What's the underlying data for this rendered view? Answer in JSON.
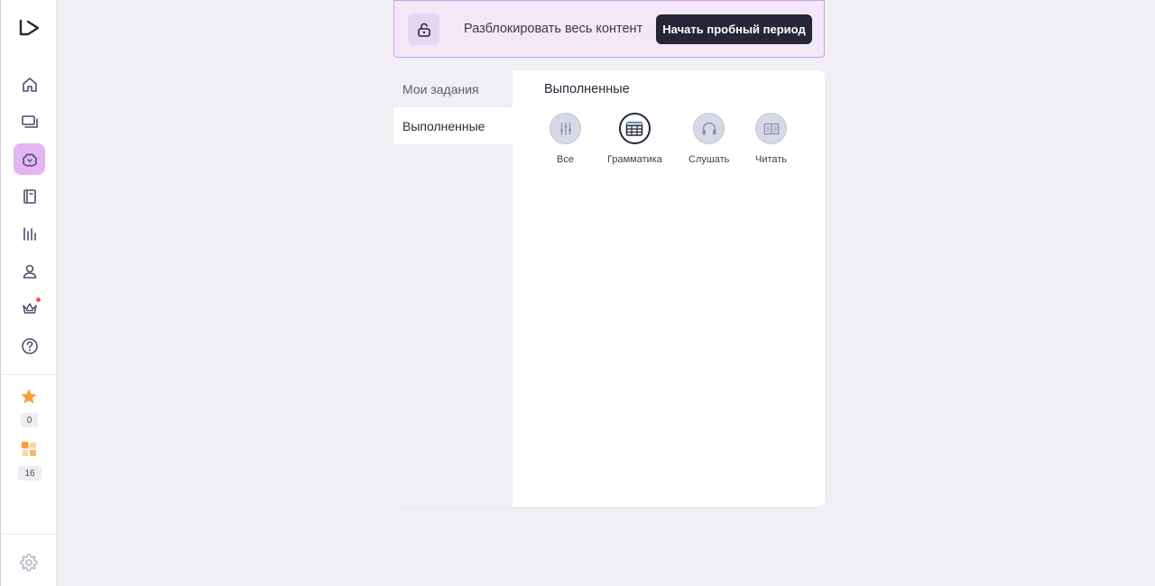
{
  "sidebar": {
    "logo": "logo-icon",
    "nav_items": [
      {
        "name": "home",
        "icon": "home-icon"
      },
      {
        "name": "lessons",
        "icon": "screens-icon"
      },
      {
        "name": "practice",
        "icon": "brain-icon",
        "active": true
      },
      {
        "name": "dictionary",
        "icon": "book-icon"
      },
      {
        "name": "progress",
        "icon": "chart-bars-icon"
      },
      {
        "name": "profile",
        "icon": "user-icon"
      },
      {
        "name": "premium",
        "icon": "crown-icon",
        "has_notification": true
      },
      {
        "name": "help",
        "icon": "help-icon"
      }
    ],
    "stars_count": "0",
    "blocks_count": "16",
    "settings_icon": "gear-icon"
  },
  "banner": {
    "icon": "unlock-icon",
    "text": "Разблокировать весь контент",
    "button_label": "Начать пробный период"
  },
  "tabs": [
    {
      "label": "Мои задания",
      "active": false
    },
    {
      "label": "Выполненные",
      "active": true
    }
  ],
  "content": {
    "title": "Выполненные",
    "filters": [
      {
        "label": "Все",
        "icon": "sliders-icon",
        "active": false
      },
      {
        "label": "Грамматика",
        "icon": "table-icon",
        "active": true
      },
      {
        "label": "Слушать",
        "icon": "headphones-icon",
        "active": false
      },
      {
        "label": "Читать",
        "icon": "open-book-icon",
        "active": false
      }
    ]
  },
  "colors": {
    "active_nav": "#e4b4f4",
    "banner_bg": "#f2e8f8",
    "button_dark": "#262637",
    "star": "#f6a03c",
    "notification": "#ff4b5c"
  }
}
